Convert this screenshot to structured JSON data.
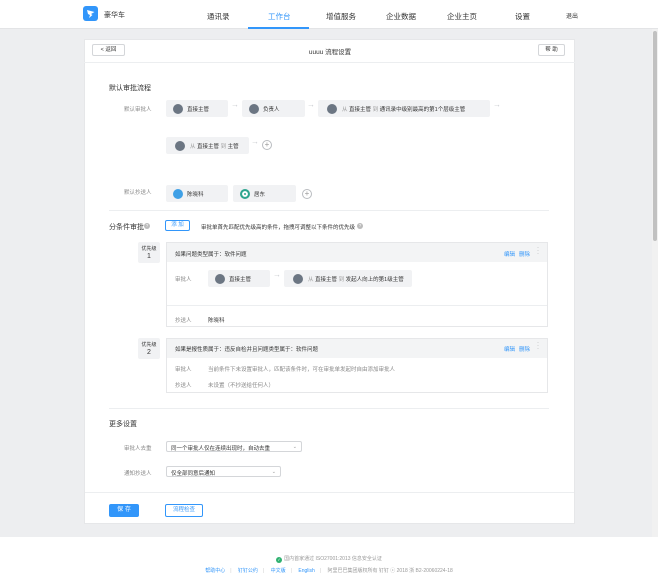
{
  "header": {
    "brand": "豪华车",
    "nav": [
      "通讯录",
      "工作台",
      "增值服务",
      "企业数据",
      "企业主页",
      "设置"
    ],
    "active": "工作台",
    "logout": "退出"
  },
  "page": {
    "back": "< 返回",
    "title": "uuuu 流程设置",
    "help": "帮 助"
  },
  "default_flow": {
    "title": "默认审批流程",
    "approver_label": "默认审批人",
    "nodes": {
      "n1": "直接主管",
      "n2": "负责人",
      "n3_from": "从",
      "n3_a": "直接主管",
      "n3_to": "到",
      "n3_b": "通讯录中级别最高的第1个层级主管",
      "n4_from": "从",
      "n4_a": "直接主管",
      "n4_to": "到",
      "n4_b": "主管"
    },
    "cc_label": "默认抄送人",
    "cc": [
      "陈晓科",
      "居东"
    ]
  },
  "conditional": {
    "title": "分条件审批",
    "add": "添 加",
    "hint": "审批单首先匹配优先级高的条件，拖拽可调整以下条件的优先级",
    "items": [
      {
        "prio_label": "优先级",
        "prio": "1",
        "condition": "如果问题类型属于：软件问题",
        "edit": "编辑",
        "delete": "删除",
        "approver_label": "审批人",
        "a1": "直接主管",
        "a2_from": "从",
        "a2_a": "直接主管",
        "a2_to": "到",
        "a2_b": "发起人向上的第1级主管",
        "cc_label": "抄送人",
        "cc": "陈晓科"
      },
      {
        "prio_label": "优先级",
        "prio": "2",
        "condition": "如果是报性质属于：违反自检并且问题类型属于：软件问题",
        "edit": "编辑",
        "delete": "删除",
        "approver_label": "审批人",
        "approver_text": "当前条件下未设置审批人，匹配该条件时，可在审批单发起时自由添加审批人",
        "cc_label": "抄送人",
        "cc_text": "未设置（不抄送给任何人）"
      }
    ]
  },
  "more": {
    "title": "更多设置",
    "dedup_label": "审批人去重",
    "dedup_value": "同一个审批人仅在连续出现时，自动去重",
    "notify_label": "通知抄送人",
    "notify_value": "仅全部同意后通知"
  },
  "actions": {
    "save": "保 存",
    "check": "流程检查"
  },
  "footer": {
    "cert": "国内首家通过 ISO27001:2013 信息安全认证",
    "links": [
      "帮助中心",
      "钉钉公约",
      "中文版",
      "English"
    ],
    "legal": "阿里巴巴集团版权所有  钉钉 ⓒ 2018 浙 B2-20060224-18"
  },
  "colors": {
    "accent": "#3296fa",
    "cert_green": "#2fb170"
  }
}
